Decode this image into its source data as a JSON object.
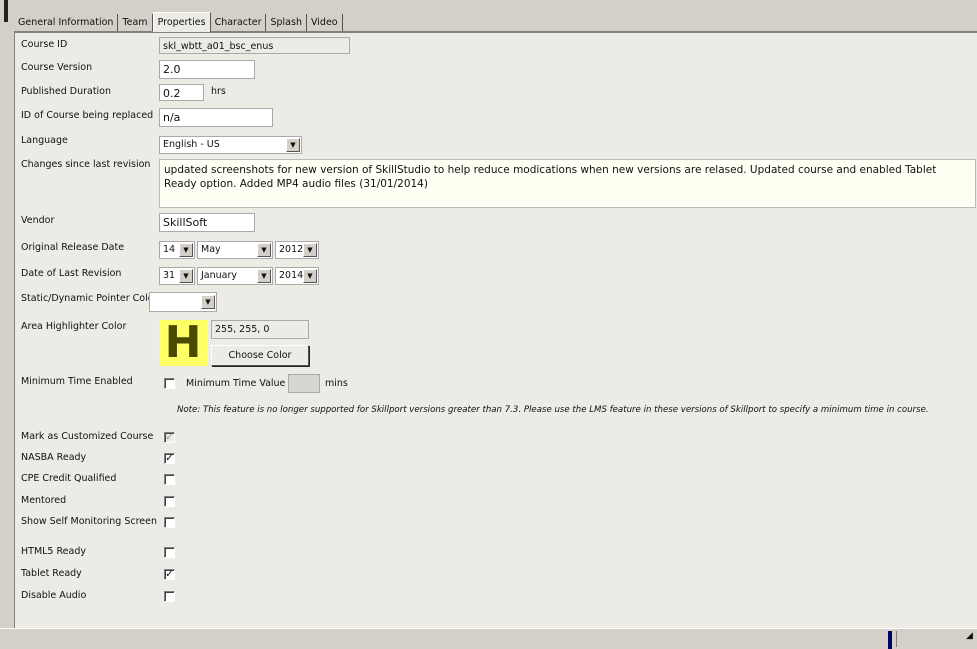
{
  "tabs": [
    "General Information",
    "Team",
    "Properties",
    "Character",
    "Splash",
    "Video"
  ],
  "labels": {
    "course_id": "Course ID",
    "course_version": "Course Version",
    "published_duration": "Published Duration",
    "id_replaced": "ID of Course being replaced",
    "language": "Language",
    "changes": "Changes since last revision",
    "vendor": "Vendor",
    "original_release": "Original Release Date",
    "last_revision": "Date of Last Revision",
    "pointer_color": "Static/Dynamic Pointer Color",
    "area_color": "Area Highlighter Color",
    "min_time_enabled": "Minimum Time Enabled",
    "min_time_value": "Minimum Time Value",
    "mins": "mins",
    "hrs": "hrs",
    "customized": "Mark as Customized Course",
    "nasba": "NASBA Ready",
    "cpe": "CPE Credit Qualified",
    "mentored": "Mentored",
    "self_monitoring": "Show Self Monitoring Screen",
    "html5": "HTML5 Ready",
    "tablet": "Tablet Ready",
    "disable_audio": "Disable Audio"
  },
  "values": {
    "course_id": "skl_wbtt_a01_bsc_enus",
    "course_version": "2.0",
    "published_duration": "0.2",
    "id_replaced": "n/a",
    "language": "English - US",
    "changes": "updated screenshots for new version of SkillStudio to help reduce modications when new versions are relased. Updated course and enabled Tablet Ready option. Added MP4 audio files (31/01/2014)",
    "vendor": "SkillSoft",
    "release_day": "14",
    "release_month": "May",
    "release_year": "2012",
    "revision_day": "31",
    "revision_month": "January",
    "revision_year": "2014",
    "highlighter_letter": "H",
    "highlighter_rgb": "255, 255, 0",
    "highlighter_color": "#ffff66",
    "highlighter_letter_color": "#4a4a00",
    "choose_color": "Choose Color",
    "note": "Note:  This feature is no longer supported for Skillport versions greater than 7.3.  Please use the LMS feature in these versions of Skillport to specify a minimum time in course."
  },
  "checkboxes": {
    "min_time_enabled": false,
    "customized": true,
    "nasba": true,
    "cpe": false,
    "mentored": false,
    "self_monitoring": false,
    "html5": false,
    "tablet": true,
    "disable_audio": false
  }
}
